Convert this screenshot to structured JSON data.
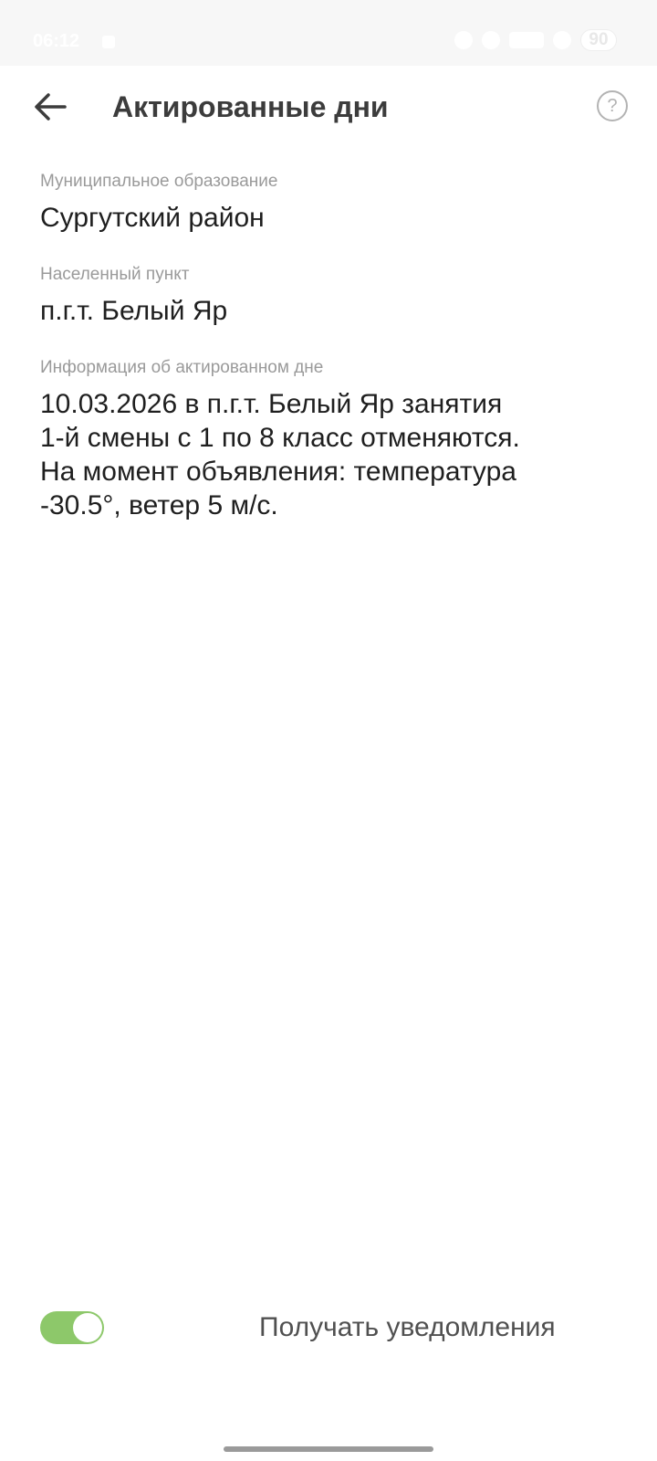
{
  "status_bar": {
    "time": "06:12",
    "battery": "90"
  },
  "header": {
    "title": "Актированные дни",
    "back_icon": "arrow-left-icon",
    "help_icon": "question-circle-icon",
    "help_glyph": "?"
  },
  "fields": [
    {
      "label": "Муниципальное образование",
      "value": "Сургутский район"
    },
    {
      "label": "Населенный пункт",
      "value": "п.г.т. Белый Яр"
    },
    {
      "label": "Информация об актированном дне",
      "value": "10.03.2026 в п.г.т. Белый Яр занятия\n1-й смены с 1 по 8 класс отменяются.\nНа момент объявления: температура\n-30.5°, ветер 5 м/с."
    }
  ],
  "notifications": {
    "label": "Получать уведомления",
    "enabled": true,
    "toggle_color": "#8dc86a"
  }
}
